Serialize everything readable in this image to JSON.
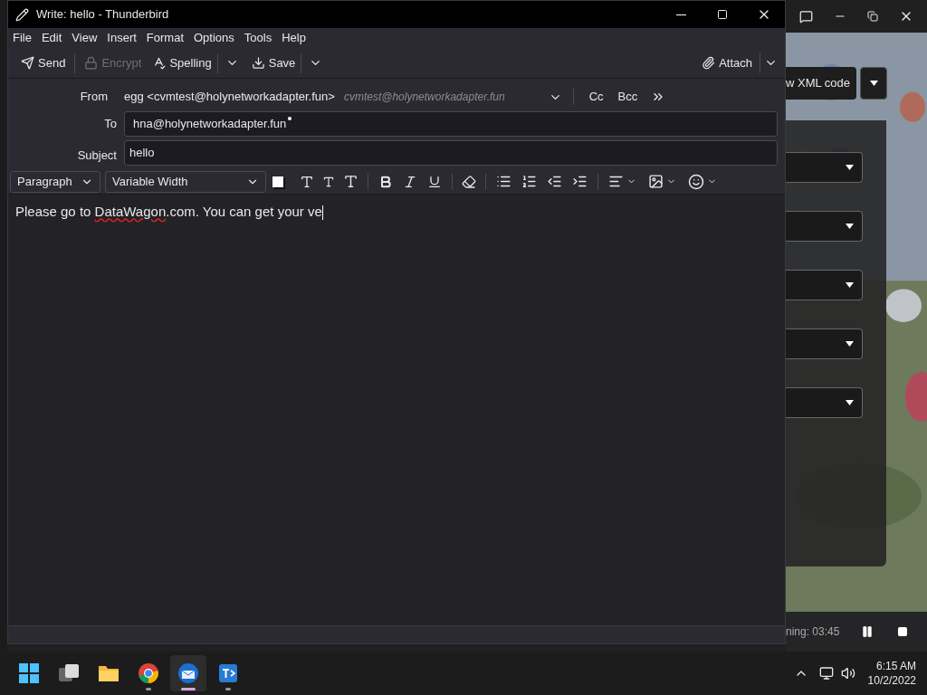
{
  "window": {
    "title": "Write: hello - Thunderbird"
  },
  "menu": [
    "File",
    "Edit",
    "View",
    "Insert",
    "Format",
    "Options",
    "Tools",
    "Help"
  ],
  "toolbar": [
    {
      "kind": "send",
      "label": "Send",
      "disabled": false
    },
    {
      "kind": "encrypt",
      "label": "Encrypt",
      "disabled": true
    },
    {
      "kind": "spelling",
      "label": "Spelling",
      "disabled": false
    },
    {
      "kind": "save",
      "label": "Save",
      "disabled": false
    }
  ],
  "attach": {
    "label": "Attach"
  },
  "header": {
    "from_label": "From",
    "from_value": "egg <cvmtest@holynetworkadapter.fun>",
    "from_identity": "cvmtest@holynetworkadapter.fun",
    "cc": "Cc",
    "bcc": "Bcc",
    "to_label": "To",
    "to_value": "hna@holynetworkadapter.fun",
    "subject_label": "Subject",
    "subject_value": "hello"
  },
  "format_bar": {
    "paragraph": "Paragraph",
    "font": "Variable Width"
  },
  "body": [
    {
      "text": "Please go to ",
      "misspelled": false
    },
    {
      "text": "DataWagon",
      "misspelled": true
    },
    {
      "text": ".com. You can get your ve",
      "misspelled": false
    }
  ],
  "background_app": {
    "button": "w XML code",
    "status": "ning: 03:45"
  },
  "taskbar": {
    "apps": [
      {
        "kind": "start",
        "selected": false,
        "running": false
      },
      {
        "kind": "taskview",
        "selected": false,
        "running": false
      },
      {
        "kind": "explorer",
        "selected": false,
        "running": false
      },
      {
        "kind": "chrome",
        "selected": false,
        "running": true
      },
      {
        "kind": "thunderbird",
        "selected": true,
        "running": true
      },
      {
        "kind": "teams",
        "selected": false,
        "running": true
      }
    ],
    "time": "6:15 AM",
    "date": "10/2/2022"
  }
}
